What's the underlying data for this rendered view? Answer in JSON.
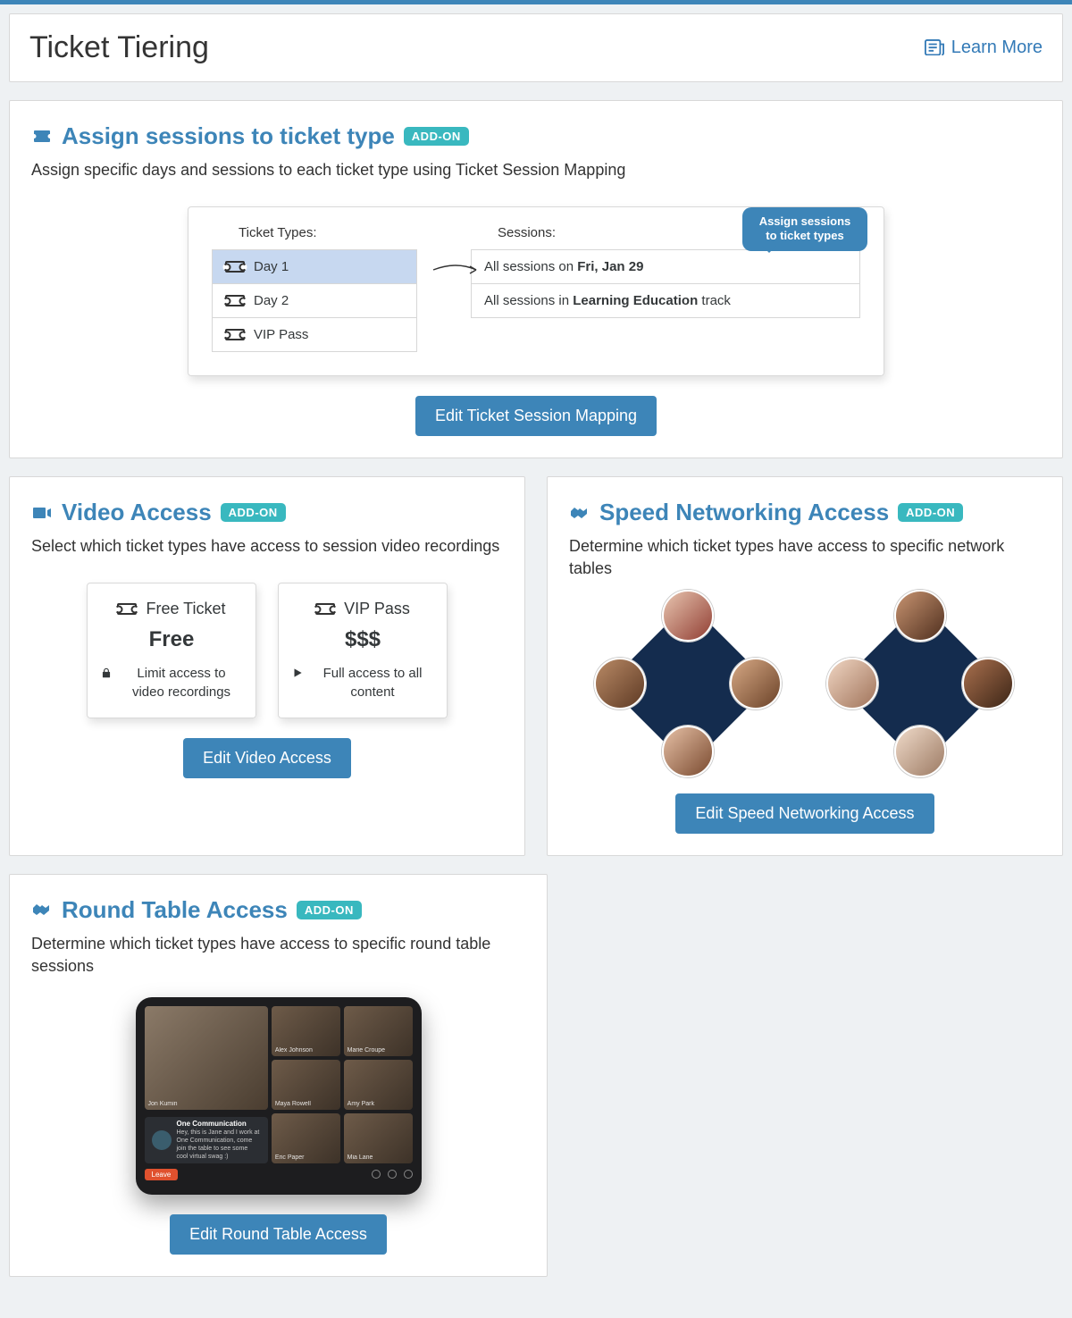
{
  "header": {
    "title": "Ticket Tiering",
    "learn_more": "Learn More"
  },
  "badge": {
    "addon": "ADD-ON"
  },
  "buttons": {
    "session_mapping": "Edit Ticket Session Mapping",
    "video_access": "Edit Video Access",
    "speed_networking": "Edit Speed Networking Access",
    "round_table": "Edit Round Table Access"
  },
  "panels": {
    "sessions": {
      "title": "Assign sessions to ticket type",
      "desc": "Assign specific days and sessions to each ticket type using Ticket Session Mapping",
      "illus": {
        "left_header": "Ticket Types:",
        "right_header": "Sessions:",
        "tooltip": "Assign sessions to ticket types",
        "left": [
          "Day 1",
          "Day 2",
          "VIP Pass"
        ],
        "right": [
          {
            "prefix": "All sessions on ",
            "bold": "Fri, Jan 29",
            "suffix": ""
          },
          {
            "prefix": "All sessions in ",
            "bold": "Learning Education",
            "suffix": " track"
          }
        ]
      }
    },
    "video": {
      "title": "Video Access",
      "desc": "Select which ticket types have access to session video recordings",
      "tickets": [
        {
          "name": "Free Ticket",
          "price": "Free",
          "note": "Limit access to video recordings",
          "icon": "lock"
        },
        {
          "name": "VIP Pass",
          "price": "$$$",
          "note": "Full access to all content",
          "icon": "play"
        }
      ]
    },
    "speed": {
      "title": "Speed Networking Access",
      "desc": "Determine which ticket types have access to specific network tables"
    },
    "round": {
      "title": "Round Table Access",
      "desc": "Determine which ticket types have access to specific round table sessions",
      "foot_title": "One Communication",
      "foot_body": "Hey, this is Jane and I work at One Communication, come join the table to see some cool virtual swag :)",
      "leave": "Leave"
    }
  }
}
